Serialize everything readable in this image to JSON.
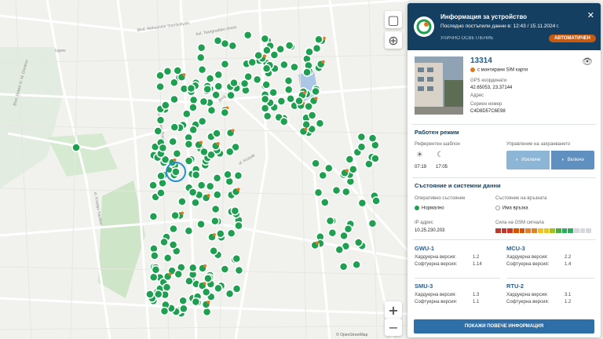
{
  "map": {
    "streets": [
      "Blvd. Aleksandar Stamboliyski",
      "Blvd. Doktor G. M. Dimitrov",
      "bul. Tsarigradsko shose",
      "Blvd. Nikola Vaptsarov",
      "Blvd. James Bourchier",
      "ul. Krastyo Sarafov",
      "ul. Kozyak",
      "Izgrev"
    ],
    "zoom_in": "+",
    "zoom_out": "−",
    "footer": "© OpenStreetMap"
  },
  "panel": {
    "title": "Информация за устройство",
    "last_data": "Последно постъпили данни в: 12:43 / 15.11.2024 г.",
    "category": "УЛИЧНО ОСВЕТЛЕНИЕ",
    "mode_badge": "АВТОМАТИЧЕН",
    "close": "✕",
    "device": {
      "id": "13314",
      "sim": "с монтирани SIM карти",
      "gps_label": "GPS координати",
      "gps": "42.65053, 23.37144",
      "address_label": "Адрес",
      "serial_label": "Сериен номер",
      "serial": "C4D8D57C6E98"
    },
    "work_mode": {
      "title": "Работен режим",
      "ref_label": "Референтен шаблон",
      "sunrise": "07:19",
      "sunset": "17:05",
      "power_label": "Управление на захранването",
      "off": "Изключи",
      "on": "Включи"
    },
    "state": {
      "title": "Състояние и системни данни",
      "op_label": "Оперативно състояние",
      "op_value": "Нормално",
      "conn_label": "Състояние на връзката",
      "conn_value": "Има връзка",
      "ip_label": "IP адрес",
      "ip": "10.25.230.203",
      "gsm_label": "Сила на GSM сигнала"
    },
    "modules": [
      {
        "name": "GWU-1",
        "hw_label": "Хардуерна версия:",
        "hw": "1.2",
        "sw_label": "Софтуерна версия:",
        "sw": "1.14"
      },
      {
        "name": "MCU-3",
        "hw_label": "Хардуерна версия:",
        "hw": "2.2",
        "sw_label": "Софтуерна версия:",
        "sw": "1.4"
      },
      {
        "name": "SMU-3",
        "hw_label": "Хардуерна версия:",
        "hw": "1.3",
        "sw_label": "Софтуерна версия:",
        "sw": "1.1"
      },
      {
        "name": "RTU-2",
        "hw_label": "Хардуерна версия:",
        "hw": "3.1",
        "sw_label": "Софтуерна версия:",
        "sw": "1.2"
      }
    ],
    "more_button": "ПОКАЖИ ПОВЕЧЕ ИНФОРМАЦИЯ"
  },
  "colors": {
    "header": "#153f60",
    "accent": "#c55a10",
    "marker": "#1fa050",
    "orange": "#e07a20"
  }
}
